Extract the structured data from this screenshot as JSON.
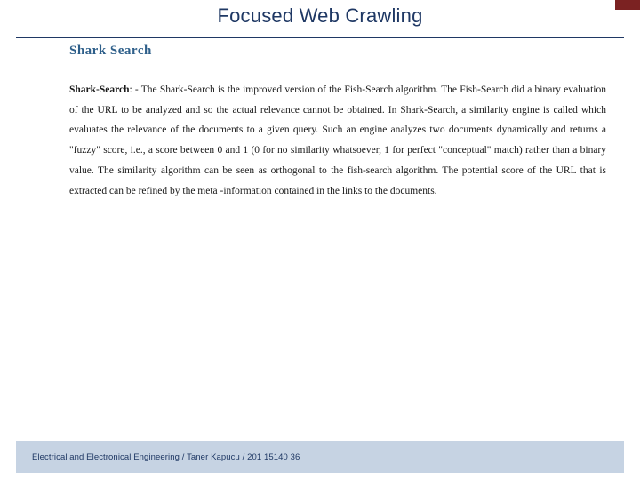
{
  "slide": {
    "title": "Focused Web Crawling",
    "section_heading": "Shark Search",
    "body_lead": "Shark-Search",
    "body_text": ": - The Shark-Search is the improved version of the Fish-Search algorithm. The Fish-Search did a binary evaluation of the URL to be analyzed and so the actual relevance cannot be obtained. In Shark-Search, a similarity engine is called which evaluates the relevance of the documents to a given query. Such an engine analyzes two documents dynamically and returns a \"fuzzy\" score, i.e., a score between 0 and 1 (0 for no similarity whatsoever, 1 for perfect \"conceptual\" match) rather than a binary value. The similarity algorithm can be seen as orthogonal to the fish-search algorithm. The potential score of the URL that is extracted can be refined by the meta -information contained in the links to the documents.",
    "footer": "Electrical and Electronical Engineering / Taner Kapucu / 201 15140 36"
  },
  "colors": {
    "title": "#1f3864",
    "heading": "#2e5f8a",
    "accent": "#7b2222",
    "footer_bar": "#c6d3e3"
  }
}
